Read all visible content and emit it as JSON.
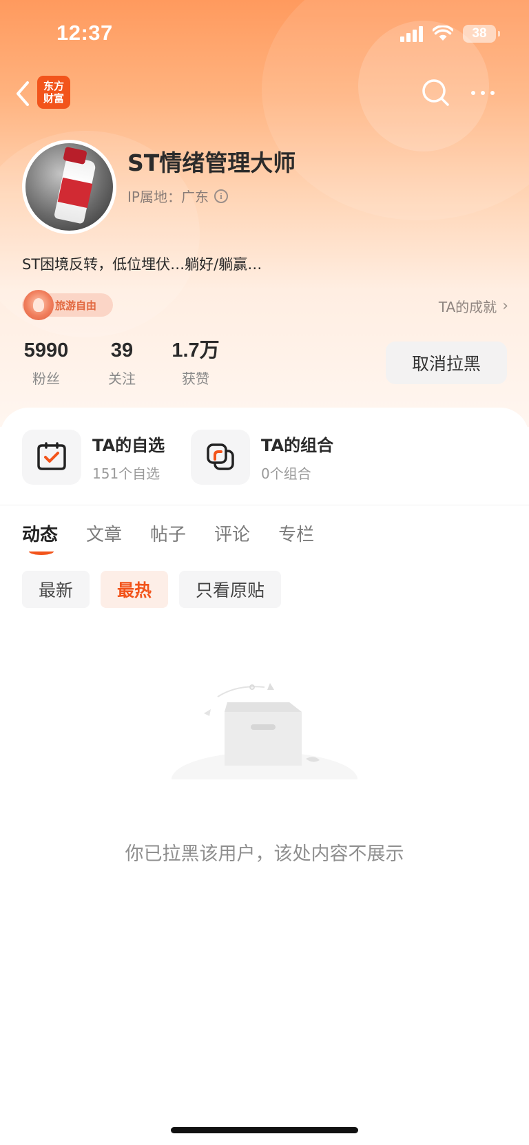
{
  "status_bar": {
    "time": "12:37",
    "battery": "38"
  },
  "nav": {
    "logo_line1": "东方",
    "logo_line2": "财富"
  },
  "profile": {
    "name": "ST情绪管理大师",
    "ip_location": "IP属地：广东",
    "bio": "ST困境反转，低位埋伏…躺好/躺赢…",
    "badge": "旅游自由",
    "achievements_link": "TA的成就"
  },
  "stats": [
    {
      "value": "5990",
      "label": "粉丝"
    },
    {
      "value": "39",
      "label": "关注"
    },
    {
      "value": "1.7万",
      "label": "获赞"
    }
  ],
  "unblock_button": "取消拉黑",
  "shortcuts": [
    {
      "title": "TA的自选",
      "subtitle": "151个自选"
    },
    {
      "title": "TA的组合",
      "subtitle": "0个组合"
    }
  ],
  "tabs": [
    "动态",
    "文章",
    "帖子",
    "评论",
    "专栏"
  ],
  "filters": [
    "最新",
    "最热",
    "只看原贴"
  ],
  "empty_state": {
    "message": "你已拉黑该用户，该处内容不展示"
  },
  "colors": {
    "accent": "#f2541b",
    "header_top": "#ff9a5e"
  }
}
